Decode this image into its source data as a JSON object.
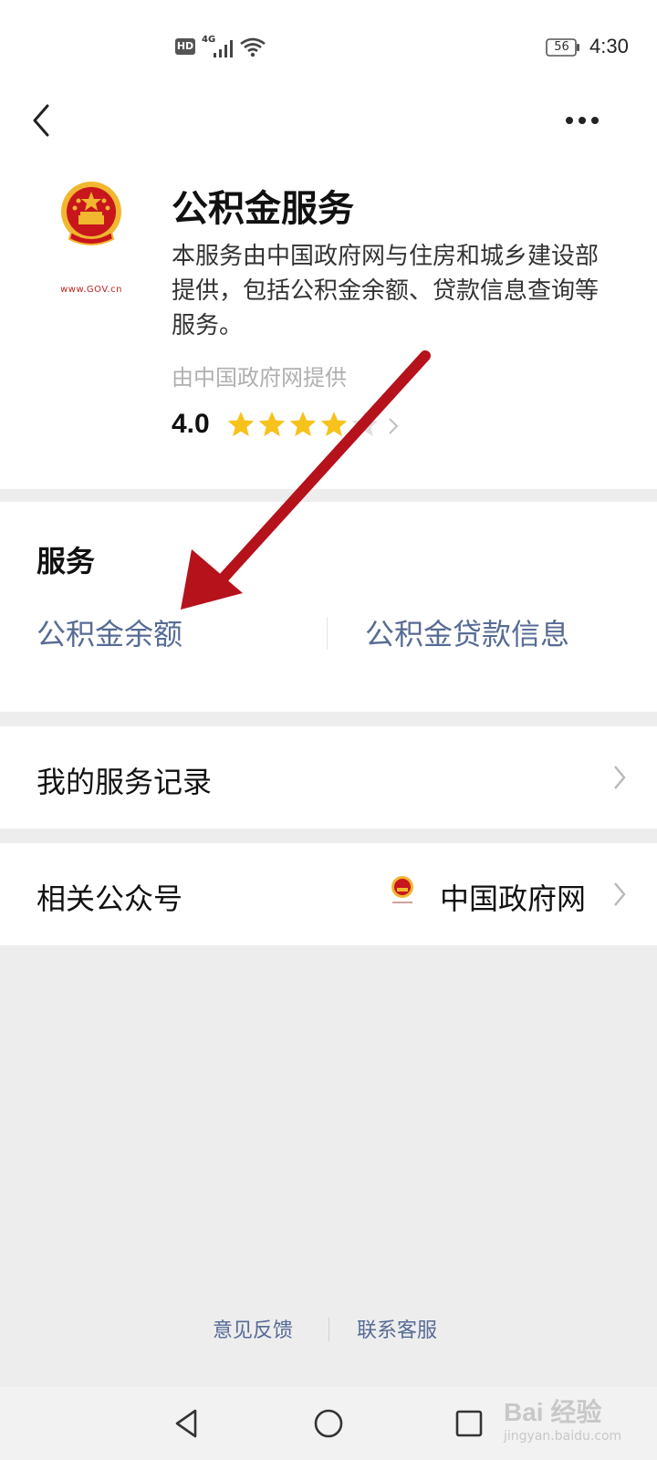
{
  "status_bar": {
    "network_badge": "HD",
    "network_type": "4G",
    "battery_level": "56",
    "time": "4:30"
  },
  "header": {
    "logo_text": "www.GOV.cn",
    "title": "公积金服务",
    "description": "本服务由中国政府网与住房和城乡建设部提供，包括公积金余额、贷款信息查询等服务。",
    "provider": "由中国政府网提供",
    "rating_value": "4.0",
    "rating_stars": 4,
    "rating_max": 5
  },
  "services": {
    "title": "服务",
    "items": [
      {
        "label": "公积金余额"
      },
      {
        "label": "公积金贷款信息"
      }
    ]
  },
  "records": {
    "label": "我的服务记录"
  },
  "related_accounts": {
    "label": "相关公众号",
    "account_name": "中国政府网"
  },
  "footer": {
    "feedback": "意见反馈",
    "contact": "联系客服"
  },
  "watermark": {
    "text": "Bai 经验",
    "sub": "jingyan.baidu.com"
  },
  "colors": {
    "link": "#576b95",
    "star": "#f7c21b",
    "star_empty": "#e0e0e0",
    "emblem_red": "#c8161d",
    "emblem_gold": "#f0b72f",
    "arrow": "#b5121b"
  },
  "icons": {
    "back": "chevron-left-icon",
    "more": "more-dots-icon",
    "rating_chevron": "chevron-right-icon",
    "row_chevron": "chevron-right-icon",
    "nav_back": "triangle-back-icon",
    "nav_home": "circle-home-icon",
    "nav_recent": "square-recent-icon"
  }
}
